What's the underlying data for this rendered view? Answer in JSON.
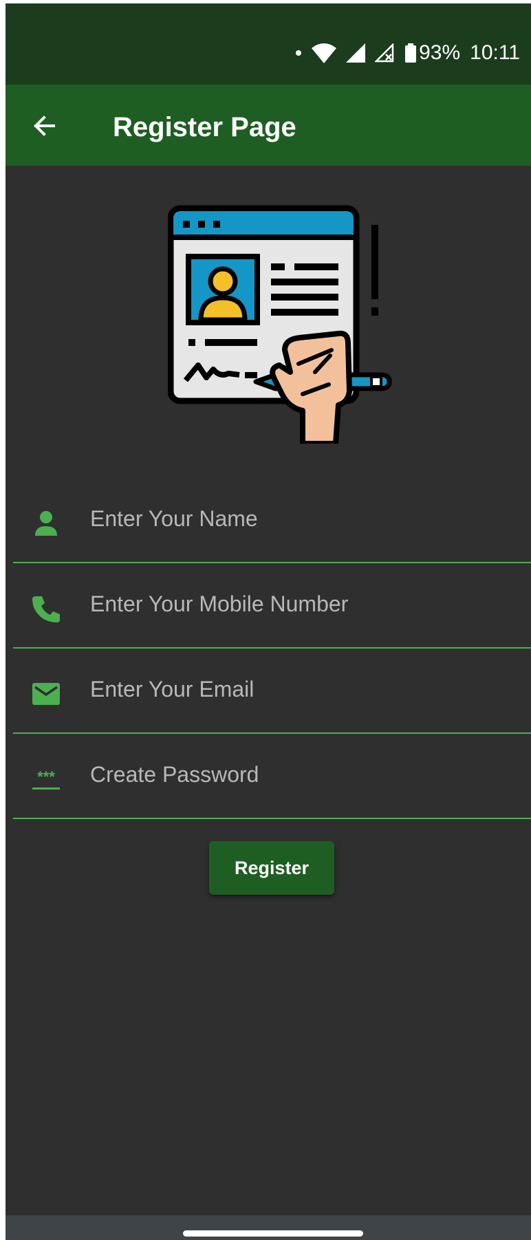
{
  "status_bar": {
    "battery": "93%",
    "time": "10:11",
    "icons": [
      "notification-dot-icon",
      "wifi-icon",
      "signal-icon",
      "signal-no-data-icon",
      "battery-icon"
    ]
  },
  "app_bar": {
    "title": "Register Page",
    "back_icon": "arrow-back-icon"
  },
  "illustration": {
    "icon": "registration-form-signing-icon"
  },
  "form": {
    "name": {
      "placeholder": "Enter Your Name",
      "value": "",
      "icon": "person-icon"
    },
    "mobile": {
      "placeholder": "Enter Your Mobile Number",
      "value": "",
      "icon": "phone-icon"
    },
    "email": {
      "placeholder": "Enter Your Email",
      "value": "",
      "icon": "email-icon"
    },
    "password": {
      "placeholder": "Create Password",
      "value": "",
      "icon": "password-icon"
    },
    "register_label": "Register"
  },
  "colors": {
    "status_bar": "#1b3d1e",
    "app_bar": "#1e5e22",
    "background": "#2f2f2f",
    "accent": "#4caf50",
    "button": "#1e5e22"
  }
}
